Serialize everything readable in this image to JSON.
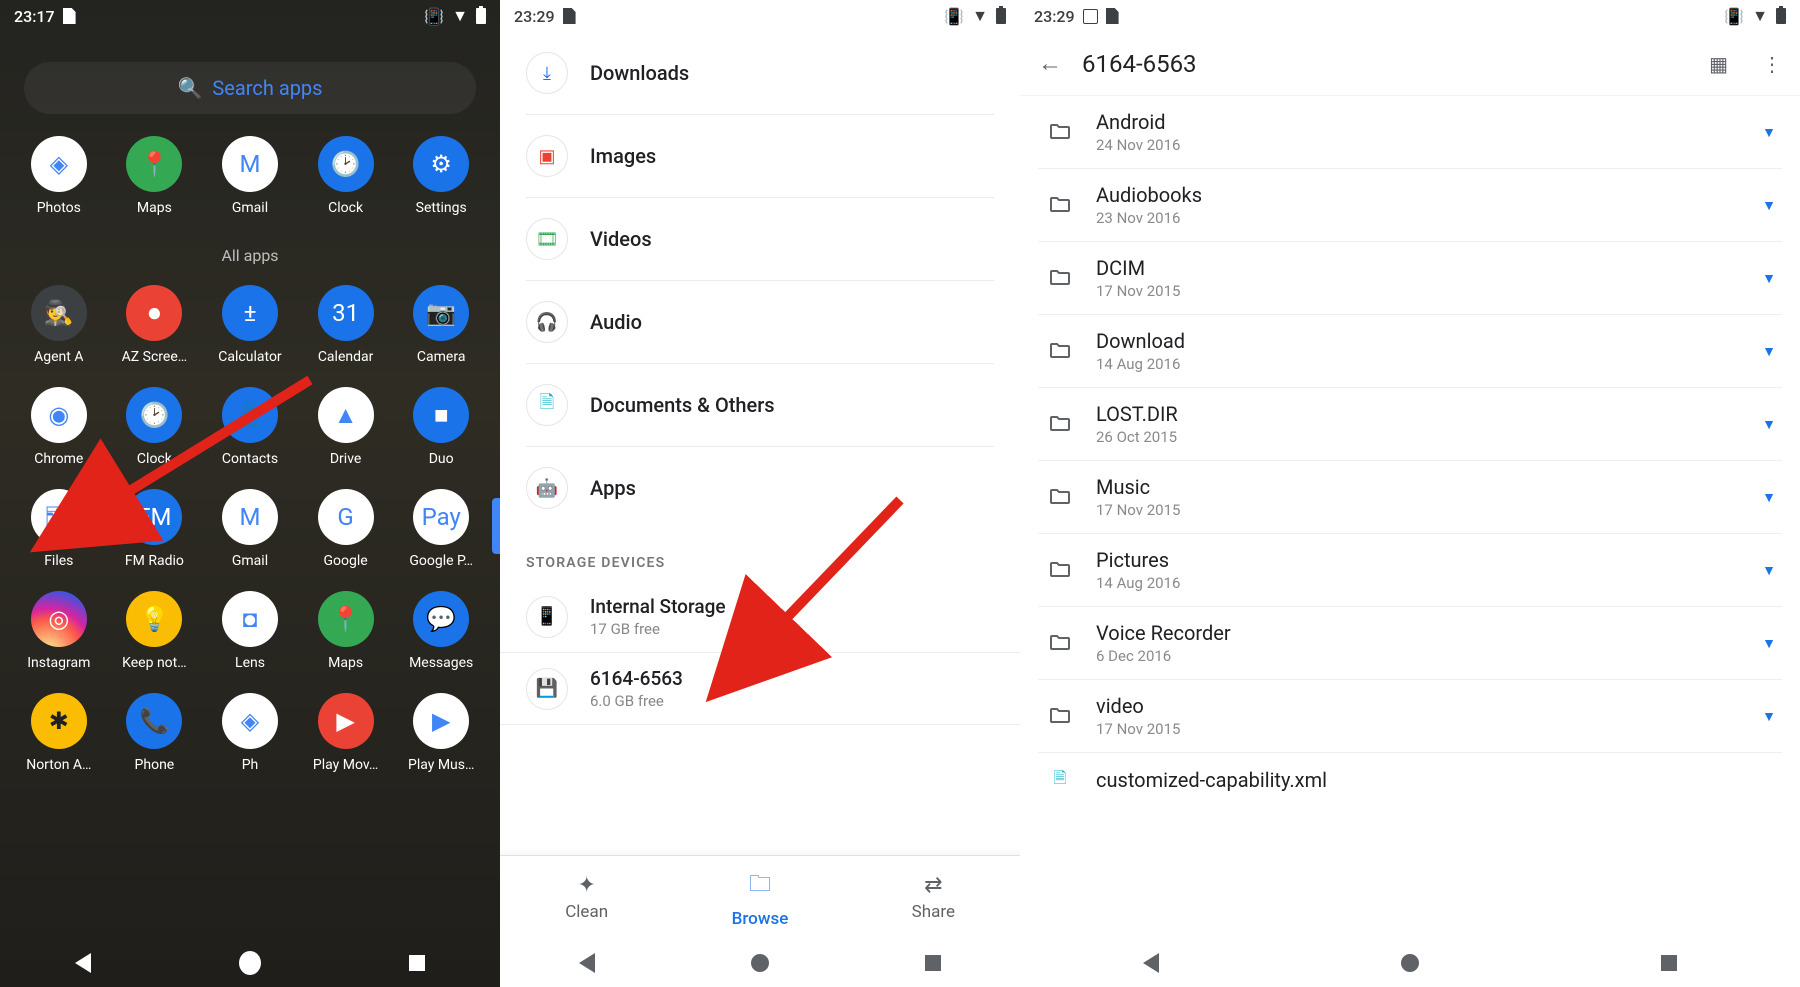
{
  "panel1": {
    "time": "23:17",
    "search_placeholder": "Search apps",
    "top_apps": [
      {
        "label": "Photos",
        "icon": "◈",
        "cls": ""
      },
      {
        "label": "Maps",
        "icon": "📍",
        "cls": "bg-g"
      },
      {
        "label": "Gmail",
        "icon": "M",
        "cls": ""
      },
      {
        "label": "Clock",
        "icon": "🕑",
        "cls": "bg-b"
      },
      {
        "label": "Settings",
        "icon": "⚙",
        "cls": "bg-b"
      }
    ],
    "all_label": "All apps",
    "apps": [
      {
        "label": "Agent A",
        "icon": "🕵",
        "cls": "bg-dk"
      },
      {
        "label": "AZ Scree…",
        "icon": "⏺",
        "cls": "bg-r"
      },
      {
        "label": "Calculator",
        "icon": "±",
        "cls": "bg-b"
      },
      {
        "label": "Calendar",
        "icon": "31",
        "cls": "bg-b"
      },
      {
        "label": "Camera",
        "icon": "📷",
        "cls": "bg-b"
      },
      {
        "label": "Chrome",
        "icon": "◉",
        "cls": ""
      },
      {
        "label": "Clock",
        "icon": "🕑",
        "cls": "bg-b"
      },
      {
        "label": "Contacts",
        "icon": "👤",
        "cls": "bg-b"
      },
      {
        "label": "Drive",
        "icon": "▲",
        "cls": ""
      },
      {
        "label": "Duo",
        "icon": "■",
        "cls": "bg-b"
      },
      {
        "label": "Files",
        "icon": "🗂",
        "cls": ""
      },
      {
        "label": "FM Radio",
        "icon": "FM",
        "cls": "bg-b"
      },
      {
        "label": "Gmail",
        "icon": "M",
        "cls": ""
      },
      {
        "label": "Google",
        "icon": "G",
        "cls": ""
      },
      {
        "label": "Google P…",
        "icon": "Pay",
        "cls": ""
      },
      {
        "label": "Instagram",
        "icon": "◎",
        "cls": "bg-grad-ins"
      },
      {
        "label": "Keep not…",
        "icon": "💡",
        "cls": "bg-y"
      },
      {
        "label": "Lens",
        "icon": "◘",
        "cls": ""
      },
      {
        "label": "Maps",
        "icon": "📍",
        "cls": "bg-g"
      },
      {
        "label": "Messages",
        "icon": "💬",
        "cls": "bg-b"
      },
      {
        "label": "Norton A…",
        "icon": "✱",
        "cls": "bg-y"
      },
      {
        "label": "Phone",
        "icon": "📞",
        "cls": "bg-b"
      },
      {
        "label": "Ph",
        "icon": "◈",
        "cls": ""
      },
      {
        "label": "Play Mov…",
        "icon": "▶",
        "cls": "bg-r"
      },
      {
        "label": "Play Mus…",
        "icon": "▶",
        "cls": ""
      }
    ]
  },
  "panel2": {
    "time": "23:29",
    "categories": [
      {
        "name": "Downloads",
        "icon": "⤓",
        "color": "#1a73e8"
      },
      {
        "name": "Images",
        "icon": "▣",
        "color": "#ea4335"
      },
      {
        "name": "Videos",
        "icon": "🎞",
        "color": "#34a853"
      },
      {
        "name": "Audio",
        "icon": "🎧",
        "color": "#a142f4"
      },
      {
        "name": "Documents & Others",
        "icon": "🗎",
        "color": "#12b5cb"
      },
      {
        "name": "Apps",
        "icon": "🤖",
        "color": "#5f6368"
      }
    ],
    "storage_head": "STORAGE DEVICES",
    "storage": [
      {
        "name": "Internal Storage",
        "sub": "17 GB free",
        "icon": "📱"
      },
      {
        "name": "6164-6563",
        "sub": "6.0 GB free",
        "icon": "💾"
      }
    ],
    "tabs": [
      {
        "label": "Clean",
        "icon": "✦",
        "active": false
      },
      {
        "label": "Browse",
        "icon": "🗀",
        "active": true
      },
      {
        "label": "Share",
        "icon": "⇄",
        "active": false
      }
    ]
  },
  "panel3": {
    "time": "23:29",
    "title": "6164-6563",
    "folders": [
      {
        "name": "Android",
        "date": "24 Nov 2016"
      },
      {
        "name": "Audiobooks",
        "date": "23 Nov 2016"
      },
      {
        "name": "DCIM",
        "date": "17 Nov 2015"
      },
      {
        "name": "Download",
        "date": "14 Aug 2016"
      },
      {
        "name": "LOST.DIR",
        "date": "26 Oct 2015"
      },
      {
        "name": "Music",
        "date": "17 Nov 2015"
      },
      {
        "name": "Pictures",
        "date": "14 Aug 2016"
      },
      {
        "name": "Voice Recorder",
        "date": "6 Dec 2016"
      },
      {
        "name": "video",
        "date": "17 Nov 2015"
      }
    ],
    "partial_file": "customized-capability.xml"
  }
}
